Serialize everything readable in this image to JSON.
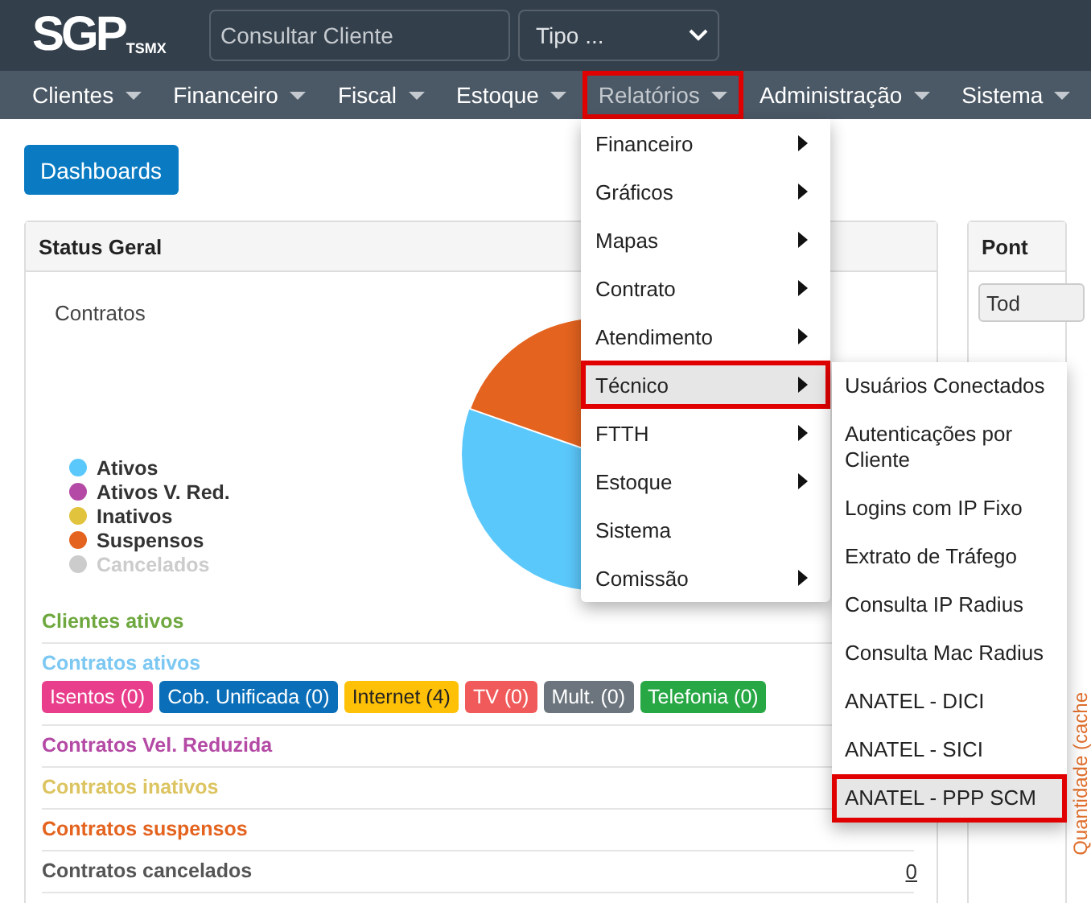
{
  "logo": {
    "text": "SGP",
    "subtext": "TSMX"
  },
  "search": {
    "placeholder": "Consultar Cliente"
  },
  "type_select": {
    "value": "Tipo ..."
  },
  "nav": [
    {
      "label": "Clientes",
      "selected": false,
      "highlighted": false
    },
    {
      "label": "Financeiro",
      "selected": false,
      "highlighted": false
    },
    {
      "label": "Fiscal",
      "selected": false,
      "highlighted": false
    },
    {
      "label": "Estoque",
      "selected": false,
      "highlighted": false
    },
    {
      "label": "Relatórios",
      "selected": true,
      "highlighted": true
    },
    {
      "label": "Administração",
      "selected": false,
      "highlighted": false
    },
    {
      "label": "Sistema",
      "selected": false,
      "highlighted": false
    }
  ],
  "dashboards_button": "Dashboards",
  "status_panel": {
    "title": "Status Geral",
    "chart_title": "Contratos",
    "legend": [
      {
        "label": "Ativos",
        "color": "#5bc8fb",
        "disabled": false
      },
      {
        "label": "Ativos V. Red.",
        "color": "#b44aa5",
        "disabled": false
      },
      {
        "label": "Inativos",
        "color": "#e1c33d",
        "disabled": false
      },
      {
        "label": "Suspensos",
        "color": "#e4631f",
        "disabled": false
      },
      {
        "label": "Cancelados",
        "color": "#cccccc",
        "disabled": true
      }
    ],
    "rows": [
      {
        "title": "Clientes ativos",
        "color": "#6ea83f"
      },
      {
        "title": "Contratos ativos",
        "color": "#7cc8f2",
        "badges": [
          {
            "label": "Isentos (0)",
            "color": "#e83e8c"
          },
          {
            "label": "Cob. Unificada (0)",
            "color": "#0a6fb8"
          },
          {
            "label": "Internet (4)",
            "color": "#ffc107"
          },
          {
            "label": "TV (0)",
            "color": "#f05a5a"
          },
          {
            "label": "Mult. (0)",
            "color": "#6c757d"
          },
          {
            "label": "Telefonia (0)",
            "color": "#28a745"
          }
        ]
      },
      {
        "title": "Contratos Vel. Reduzida",
        "color": "#b44aa5"
      },
      {
        "title": "Contratos inativos",
        "color": "#dcc460"
      },
      {
        "title": "Contratos suspensos",
        "color": "#e4631f"
      },
      {
        "title": "Contratos cancelados",
        "color": "#555555",
        "value": "0"
      }
    ]
  },
  "side_panel": {
    "title": "Pont",
    "select": "Tod",
    "vertical_label": "Quantidade (cache"
  },
  "menu": [
    {
      "label": "Financeiro",
      "submenu": true,
      "selected": false,
      "highlighted": false
    },
    {
      "label": "Gráficos",
      "submenu": true,
      "selected": false,
      "highlighted": false
    },
    {
      "label": "Mapas",
      "submenu": true,
      "selected": false,
      "highlighted": false
    },
    {
      "label": "Contrato",
      "submenu": true,
      "selected": false,
      "highlighted": false
    },
    {
      "label": "Atendimento",
      "submenu": true,
      "selected": false,
      "highlighted": false
    },
    {
      "label": "Técnico",
      "submenu": true,
      "selected": true,
      "highlighted": true
    },
    {
      "label": "FTTH",
      "submenu": true,
      "selected": false,
      "highlighted": false
    },
    {
      "label": "Estoque",
      "submenu": true,
      "selected": false,
      "highlighted": false
    },
    {
      "label": "Sistema",
      "submenu": false,
      "selected": false,
      "highlighted": false
    },
    {
      "label": "Comissão",
      "submenu": true,
      "selected": false,
      "highlighted": false
    }
  ],
  "submenu": [
    {
      "label": "Usuários Conectados",
      "selected": false,
      "highlighted": false
    },
    {
      "label": "Autenticações por Cliente",
      "selected": false,
      "highlighted": false
    },
    {
      "label": "Logins com IP Fixo",
      "selected": false,
      "highlighted": false
    },
    {
      "label": "Extrato de Tráfego",
      "selected": false,
      "highlighted": false
    },
    {
      "label": "Consulta IP Radius",
      "selected": false,
      "highlighted": false
    },
    {
      "label": "Consulta Mac Radius",
      "selected": false,
      "highlighted": false
    },
    {
      "label": "ANATEL - DICI",
      "selected": false,
      "highlighted": false
    },
    {
      "label": "ANATEL - SICI",
      "selected": false,
      "highlighted": false
    },
    {
      "label": "ANATEL - PPP SCM",
      "selected": true,
      "highlighted": true
    }
  ]
}
